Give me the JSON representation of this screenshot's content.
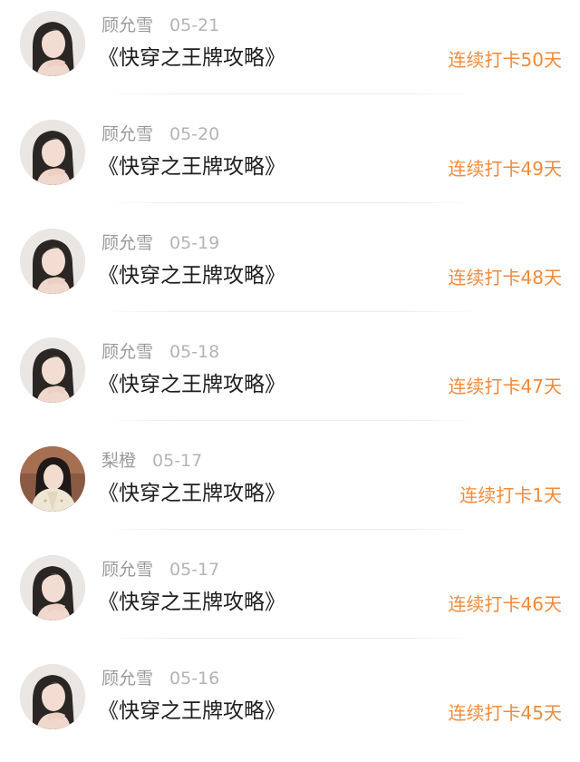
{
  "colors": {
    "streak": "#f08a3c",
    "username": "#9a9a9a",
    "title": "#1e1e1e"
  },
  "checkins": [
    {
      "user": "顾允雪",
      "date": "05-21",
      "title": "《快穿之王牌攻略》",
      "streak": "连续打卡50天",
      "avatar": "avatar-girl-long-hair"
    },
    {
      "user": "顾允雪",
      "date": "05-20",
      "title": "《快穿之王牌攻略》",
      "streak": "连续打卡49天",
      "avatar": "avatar-girl-long-hair"
    },
    {
      "user": "顾允雪",
      "date": "05-19",
      "title": "《快穿之王牌攻略》",
      "streak": "连续打卡48天",
      "avatar": "avatar-girl-long-hair"
    },
    {
      "user": "顾允雪",
      "date": "05-18",
      "title": "《快穿之王牌攻略》",
      "streak": "连续打卡47天",
      "avatar": "avatar-girl-long-hair"
    },
    {
      "user": "梨橙",
      "date": "05-17",
      "title": "《快穿之王牌攻略》",
      "streak": "连续打卡1天",
      "avatar": "avatar-girl-cream-jacket"
    },
    {
      "user": "顾允雪",
      "date": "05-17",
      "title": "《快穿之王牌攻略》",
      "streak": "连续打卡46天",
      "avatar": "avatar-girl-long-hair"
    },
    {
      "user": "顾允雪",
      "date": "05-16",
      "title": "《快穿之王牌攻略》",
      "streak": "连续打卡45天",
      "avatar": "avatar-girl-long-hair"
    }
  ]
}
